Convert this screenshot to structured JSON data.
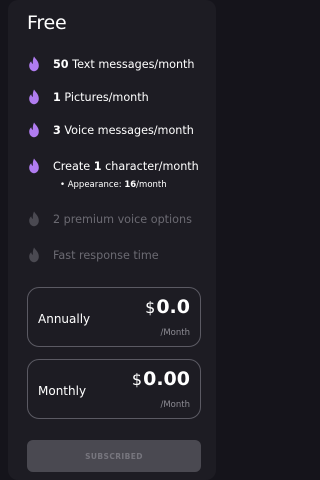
{
  "plan": {
    "title": "Free"
  },
  "features": [
    {
      "strong": "50",
      "text": "Text messages/month",
      "active": true
    },
    {
      "strong": "1",
      "text": "Pictures/month",
      "active": true
    },
    {
      "strong": "3",
      "text": "Voice messages/month",
      "active": true
    },
    {
      "pre": "Create",
      "strong": "1",
      "text": "character/month",
      "active": true
    },
    {
      "text": "2 premium voice options",
      "active": false
    },
    {
      "text": "Fast response time",
      "active": false
    }
  ],
  "appearance": {
    "label": "Appearance:",
    "value": "16",
    "suffix": "/month"
  },
  "pricing": {
    "annually": {
      "label": "Annually",
      "currency": "$",
      "amount": "0.0",
      "per": "/Month"
    },
    "monthly": {
      "label": "Monthly",
      "currency": "$",
      "amount": "0.00",
      "per": "/Month"
    }
  },
  "button": {
    "label": "SUBSCRIBED"
  },
  "colors": {
    "active_flame": "#b07cf0",
    "inactive_flame": "#4a4951",
    "background": "#15141b",
    "card": "#1d1c23"
  },
  "icons": {
    "feature_bullet": "flame-icon"
  }
}
